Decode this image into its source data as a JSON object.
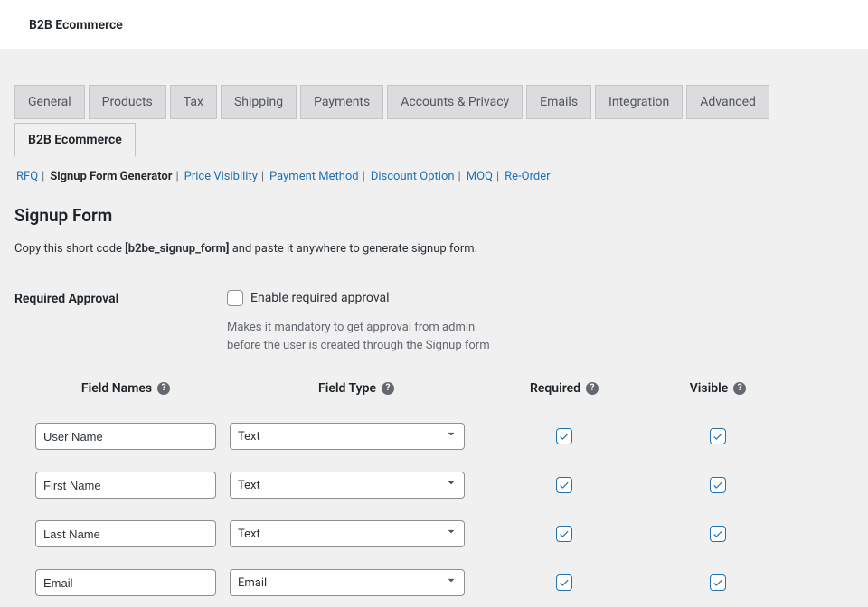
{
  "topbar": {
    "title": "B2B Ecommerce"
  },
  "tabs": [
    "General",
    "Products",
    "Tax",
    "Shipping",
    "Payments",
    "Accounts & Privacy",
    "Emails",
    "Integration",
    "Advanced",
    "B2B Ecommerce"
  ],
  "active_tab_index": 9,
  "subnav": {
    "items": [
      "RFQ",
      "Signup Form Generator",
      "Price Visibility",
      "Payment Method",
      "Discount Option",
      "MOQ",
      "Re-Order"
    ],
    "current_index": 1
  },
  "heading": "Signup Form",
  "shortcode_line": {
    "prefix": "Copy this short code ",
    "code": "[b2be_signup_form]",
    "suffix": " and paste it anywhere to generate signup form."
  },
  "approval": {
    "label": "Required Approval",
    "checkbox_label": "Enable required approval",
    "checked": false,
    "help": "Makes it mandatory to get approval from admin before the user is created through the Signup form"
  },
  "columns": {
    "name": "Field Names",
    "type": "Field Type",
    "required": "Required",
    "visible": "Visible"
  },
  "rows": [
    {
      "name": "User Name",
      "type": "Text",
      "required": true,
      "visible": true
    },
    {
      "name": "First Name",
      "type": "Text",
      "required": true,
      "visible": true
    },
    {
      "name": "Last Name",
      "type": "Text",
      "required": true,
      "visible": true
    },
    {
      "name": "Email",
      "type": "Email",
      "required": true,
      "visible": true
    }
  ]
}
